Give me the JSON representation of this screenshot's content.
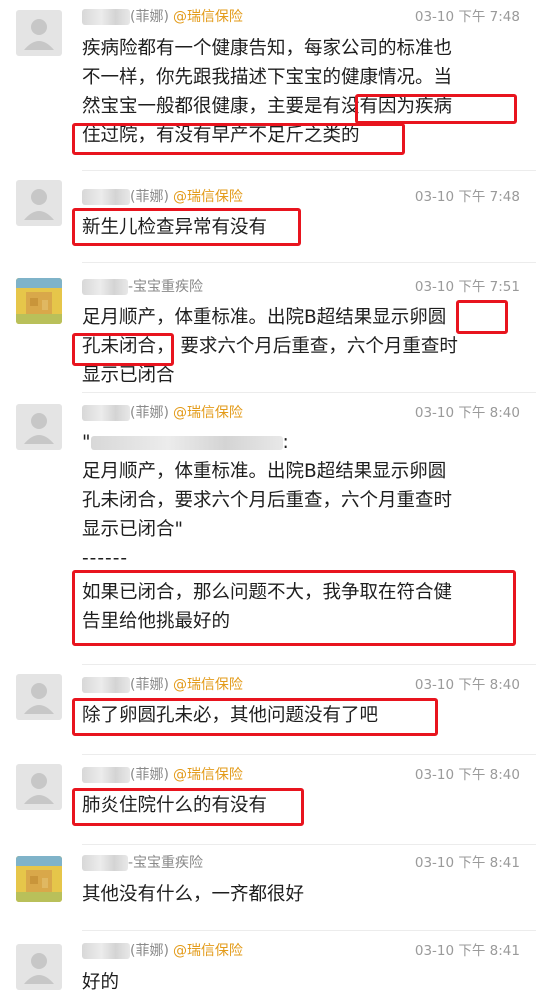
{
  "messages": [
    {
      "nick": "(菲娜)",
      "tag": "@瑞信保险",
      "time": "03-10 下午 7:48",
      "lines": [
        "疾病险都有一个健康告知，每家公司的标准也",
        "不一样，你先跟我描述下宝宝的健康情况。当",
        "然宝宝一般都很健康，主要是有没有因为疾病",
        "住过院，有没有早产不足斤之类的"
      ]
    },
    {
      "nick": "(菲娜)",
      "tag": "@瑞信保险",
      "time": "03-10 下午 7:48",
      "lines": [
        "新生儿检查异常有没有"
      ]
    },
    {
      "nick": "-宝宝重疾险",
      "tag": "",
      "time": "03-10 下午 7:51",
      "lines": [
        "足月顺产，体重标准。出院B超结果显示卵圆",
        "孔未闭合， 要求六个月后重查，六个月重查时",
        "显示已闭合"
      ]
    },
    {
      "nick": "(菲娜)",
      "tag": "@瑞信保险",
      "time": "03-10 下午 8:40",
      "quote_open": "\"",
      "quote_colon": ":",
      "lines": [
        "足月顺产，体重标准。出院B超结果显示卵圆",
        "孔未闭合，要求六个月后重查，六个月重查时",
        "显示已闭合\""
      ],
      "divider": "------",
      "reply": [
        "如果已闭合，那么问题不大，我争取在符合健",
        "告里给他挑最好的"
      ]
    },
    {
      "nick": "(菲娜)",
      "tag": "@瑞信保险",
      "time": "03-10 下午 8:40",
      "lines": [
        "除了卵圆孔未必，其他问题没有了吧"
      ]
    },
    {
      "nick": "(菲娜)",
      "tag": "@瑞信保险",
      "time": "03-10 下午 8:40",
      "lines": [
        "肺炎住院什么的有没有"
      ]
    },
    {
      "nick": "-宝宝重疾险",
      "tag": "",
      "time": "03-10 下午 8:41",
      "lines": [
        "其他没有什么，一齐都很好"
      ]
    },
    {
      "nick": "(菲娜)",
      "tag": "@瑞信保险",
      "time": "03-10 下午 8:41",
      "lines": [
        "好的"
      ]
    }
  ],
  "colors": {
    "highlight": "#e8141e",
    "tag": "#e39b1a",
    "time": "#9a9a9a"
  },
  "icons": {
    "default_avatar": "person-silhouette-icon",
    "user_avatar": "yellow-cartoon-avatar-icon"
  }
}
